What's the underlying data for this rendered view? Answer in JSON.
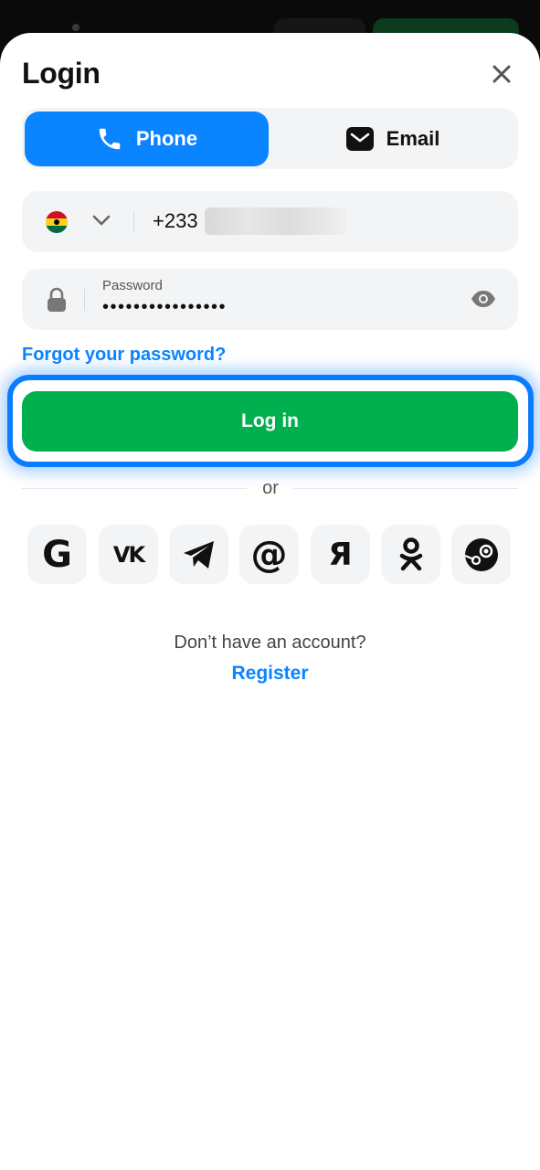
{
  "header": {
    "title": "Login"
  },
  "tabs": [
    {
      "label": "Phone",
      "icon": "phone-icon",
      "active": true
    },
    {
      "label": "Email",
      "icon": "mail-icon",
      "active": false
    }
  ],
  "phone": {
    "country_code": "+233",
    "flag": "ghana-flag-icon"
  },
  "password": {
    "label": "Password",
    "value": "••••••••••••••••"
  },
  "links": {
    "forgot": "Forgot your password?",
    "register": "Register"
  },
  "login_button": {
    "label": "Log in"
  },
  "divider": {
    "text": "or"
  },
  "social": [
    {
      "name": "google",
      "glyph": "G"
    },
    {
      "name": "vk",
      "glyph": "VK"
    },
    {
      "name": "telegram",
      "glyph": ""
    },
    {
      "name": "mail",
      "glyph": "@"
    },
    {
      "name": "yandex",
      "glyph": "Я"
    },
    {
      "name": "odnoklassniki",
      "glyph": ""
    },
    {
      "name": "steam",
      "glyph": ""
    }
  ],
  "footer": {
    "no_account": "Don’t have an account?"
  },
  "colors": {
    "accent": "#0a84ff",
    "login_green": "#00b04f",
    "field_bg": "#f3f4f6"
  }
}
